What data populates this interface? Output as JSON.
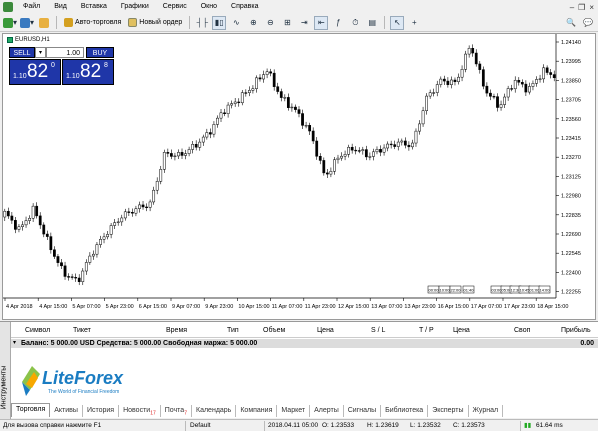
{
  "menu": [
    "Файл",
    "Вид",
    "Вставка",
    "Графики",
    "Сервис",
    "Окно",
    "Справка"
  ],
  "toolbar": {
    "autotrade_label": "Авто-торговля",
    "neworder_label": "Новый ордер"
  },
  "chart": {
    "symbol_tab": "EURUSD,H1",
    "one_click": {
      "sell_label": "SELL",
      "buy_label": "BUY",
      "volume": "1.00",
      "sell_prefix": "1.10",
      "sell_big": "82",
      "sell_sup": "0",
      "buy_prefix": "1.10",
      "buy_big": "82",
      "buy_sup": "8"
    },
    "price_labels": [
      "1.24140",
      "1.23995",
      "1.23850",
      "1.23705",
      "1.23560",
      "1.23415",
      "1.23270",
      "1.23125",
      "1.22980",
      "1.22835",
      "1.22690",
      "1.22545",
      "1.22400",
      "1.22255"
    ],
    "time_labels": [
      "4 Apr 2018",
      "4 Apr 15:00",
      "5 Apr 07:00",
      "5 Apr 23:00",
      "6 Apr 15:00",
      "9 Apr 07:00",
      "9 Apr 23:00",
      "10 Apr 15:00",
      "11 Apr 07:00",
      "11 Apr 23:00",
      "12 Apr 15:00",
      "13 Apr 07:00",
      "13 Apr 23:00",
      "16 Apr 15:00",
      "17 Apr 07:00",
      "17 Apr 23:00",
      "18 Apr 15:00"
    ],
    "period_boxes": [
      "00:00",
      "10:00",
      "22:00",
      "01:40",
      "03:00",
      "05:00",
      "12:30",
      "10:45",
      "01:00",
      "14:00"
    ]
  },
  "terminal": {
    "panel_title": "Инструменты",
    "close_glyph": "×",
    "columns": [
      "Символ",
      "Тикет",
      "Время",
      "Тип",
      "Объем",
      "Цена",
      "S / L",
      "T / P",
      "Цена",
      "Своп",
      "Прибыль"
    ],
    "balance_text": "Баланс: 5 000.00 USD  Средства: 5 000.00  Свободная маржа: 5 000.00",
    "balance_profit": "0.00",
    "logo_text": "LiteForex",
    "logo_tagline": "The World of Financial Freedom",
    "tabs": [
      {
        "label": "Торговля",
        "badge": ""
      },
      {
        "label": "Активы",
        "badge": ""
      },
      {
        "label": "История",
        "badge": ""
      },
      {
        "label": "Новости",
        "badge": "17"
      },
      {
        "label": "Почта",
        "badge": "7"
      },
      {
        "label": "Календарь",
        "badge": ""
      },
      {
        "label": "Компания",
        "badge": ""
      },
      {
        "label": "Маркет",
        "badge": ""
      },
      {
        "label": "Алерты",
        "badge": ""
      },
      {
        "label": "Сигналы",
        "badge": ""
      },
      {
        "label": "Библиотека",
        "badge": ""
      },
      {
        "label": "Эксперты",
        "badge": ""
      },
      {
        "label": "Журнал",
        "badge": ""
      }
    ]
  },
  "status": {
    "help": "Для вызова справки нажмите F1",
    "profile": "Default",
    "datetime": "2018.04.11 05:00",
    "open": "O: 1.23533",
    "high": "H: 1.23619",
    "low": "L: 1.23532",
    "close": "C: 1.23573",
    "traffic": "61.64 ms"
  },
  "colors": {
    "sell_buy_bg": "#1f36a8",
    "bullish": "#ffffff",
    "bearish": "#000000"
  }
}
